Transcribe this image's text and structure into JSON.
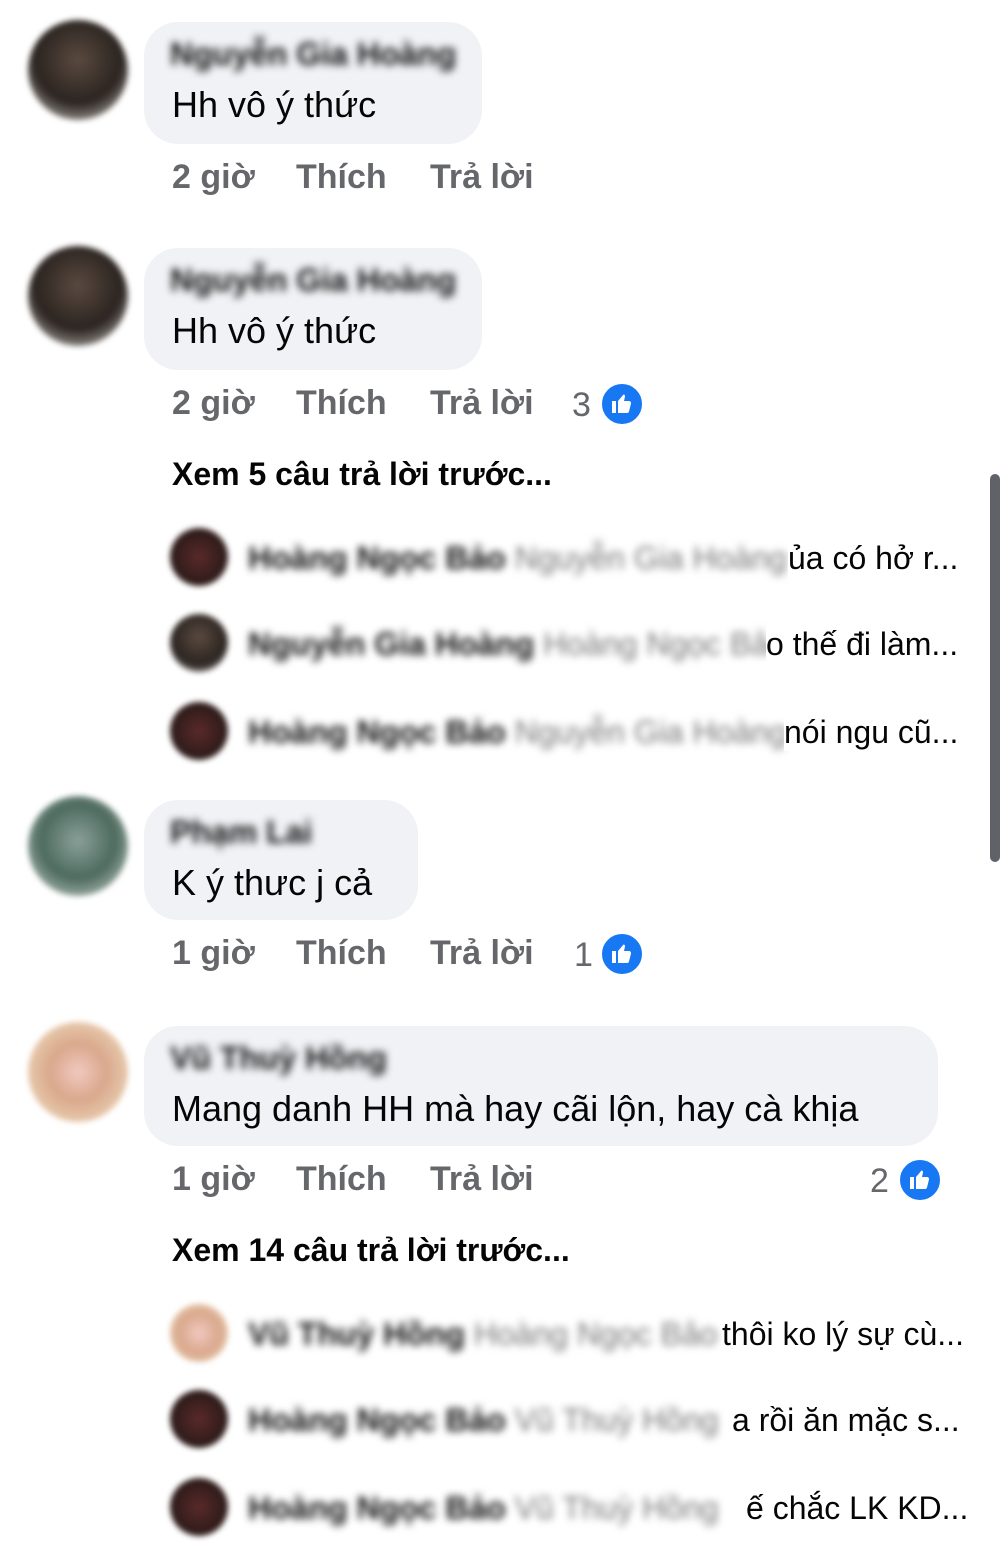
{
  "comments": [
    {
      "author": "Nguyễn Gia Hoàng",
      "text": "Hh vô ý thức",
      "time": "2 giờ",
      "like_label": "Thích",
      "reply_label": "Trả lời",
      "reactions": null
    },
    {
      "author": "Nguyễn Gia Hoàng",
      "text": "Hh vô ý thức",
      "time": "2 giờ",
      "like_label": "Thích",
      "reply_label": "Trả lời",
      "reactions": "3",
      "view_more": "Xem 5 câu trả lời trước...",
      "replies": [
        {
          "author": "Hoàng Ngọc Bảo",
          "mention": "Nguyễn Gia Hoàng",
          "text": "ủa có hở r..."
        },
        {
          "author": "Nguyễn Gia Hoàng",
          "mention": "Hoàng Ngọc Bảo",
          "text": "o thế đi làm..."
        },
        {
          "author": "Hoàng Ngọc Bảo",
          "mention": "Nguyễn Gia Hoàng",
          "text": "nói ngu cũ..."
        }
      ]
    },
    {
      "author": "Phạm Lai",
      "text": "K ý thưc j cả",
      "time": "1 giờ",
      "like_label": "Thích",
      "reply_label": "Trả lời",
      "reactions": "1"
    },
    {
      "author": "Vũ Thuỳ Hồng",
      "text": "Mang danh HH mà hay cãi lộn, hay cà khịa",
      "time": "1 giờ",
      "like_label": "Thích",
      "reply_label": "Trả lời",
      "reactions": "2",
      "view_more": "Xem 14 câu trả lời trước...",
      "replies": [
        {
          "author": "Vũ Thuỳ Hồng",
          "mention": "Hoàng Ngọc Bảo",
          "text": "thôi ko lý sự cù..."
        },
        {
          "author": "Hoàng Ngọc Bảo",
          "mention": "Vũ Thuỳ Hồng",
          "text": "a rồi ăn mặc s..."
        },
        {
          "author": "Hoàng Ngọc Bảo",
          "mention": "Vũ Thuỳ Hồng",
          "text": "ế chắc LK KD..."
        }
      ]
    }
  ],
  "colors": {
    "bubble": "#f0f2f5",
    "secondary_text": "#65676b",
    "like_blue": "#1877f2"
  },
  "icons": {
    "like": "thumbs-up-icon"
  }
}
